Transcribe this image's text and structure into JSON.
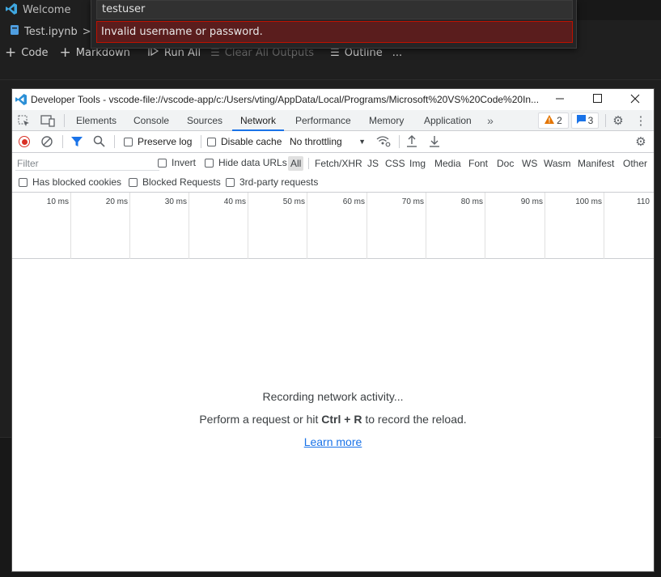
{
  "vscode": {
    "tab_title": "Welcome",
    "breadcrumb_file": "Test.ipynb",
    "breadcrumb_sep": ">",
    "toolbar": {
      "code_label": "Code",
      "markdown_label": "Markdown",
      "run_all_label": "Run All",
      "clear_outputs_label": "Clear All Outputs",
      "outline_label": "Outline",
      "more_label": "..."
    }
  },
  "quick_input": {
    "value": "testuser",
    "error": "Invalid username or password."
  },
  "devtools": {
    "title": "Developer Tools - vscode-file://vscode-app/c:/Users/vting/AppData/Local/Programs/Microsoft%20VS%20Code%20In...",
    "tabs": [
      "Elements",
      "Console",
      "Sources",
      "Network",
      "Performance",
      "Memory",
      "Application"
    ],
    "active_tab": "Network",
    "warnings_count": "2",
    "messages_count": "3",
    "toolbar": {
      "preserve_log": "Preserve log",
      "disable_cache": "Disable cache",
      "throttling": "No throttling"
    },
    "filter": {
      "placeholder": "Filter",
      "invert": "Invert",
      "hide_data_urls": "Hide data URLs",
      "types": [
        "All",
        "Fetch/XHR",
        "JS",
        "CSS",
        "Img",
        "Media",
        "Font",
        "Doc",
        "WS",
        "Wasm",
        "Manifest",
        "Other"
      ],
      "has_blocked_cookies": "Has blocked cookies",
      "blocked_requests": "Blocked Requests",
      "third_party": "3rd-party requests"
    },
    "timeline_ticks": [
      "10 ms",
      "20 ms",
      "30 ms",
      "40 ms",
      "50 ms",
      "60 ms",
      "70 ms",
      "80 ms",
      "90 ms",
      "100 ms",
      "110"
    ],
    "empty_state": {
      "line1": "Recording network activity...",
      "line2_prefix": "Perform a request or hit ",
      "shortcut": "Ctrl + R",
      "line2_suffix": " to record the reload.",
      "learn_more": "Learn more"
    }
  },
  "colors": {
    "accent": "#1a73e8",
    "error_bg": "#5a1d1d",
    "record_red": "#d93025",
    "warning": "#e37400"
  }
}
